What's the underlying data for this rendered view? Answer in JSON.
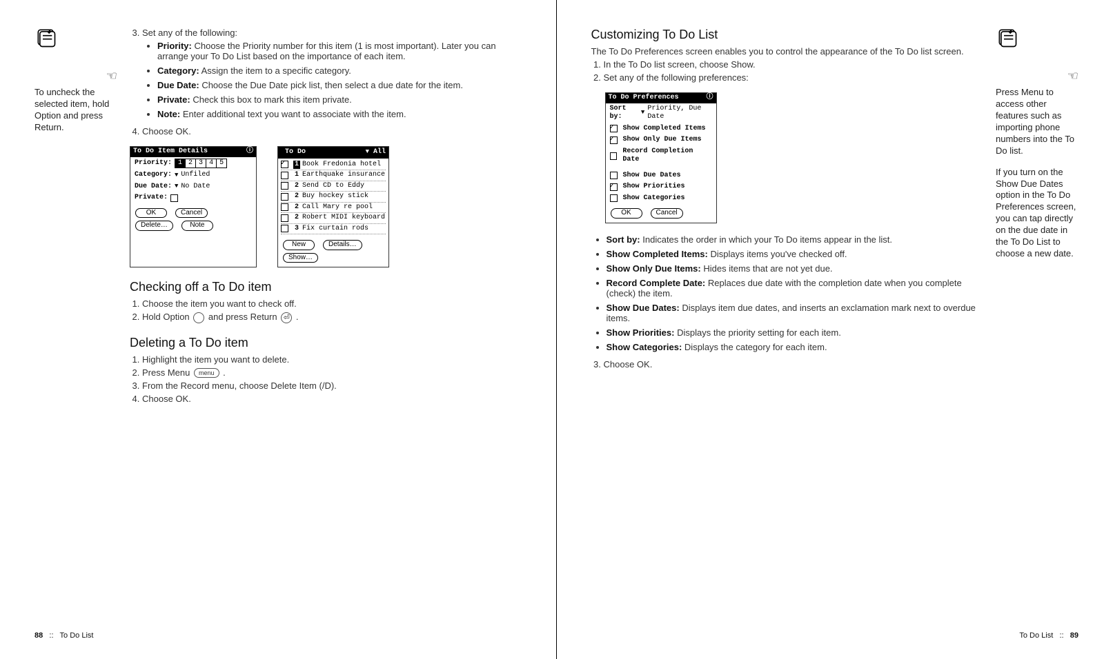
{
  "left": {
    "margin_tip": "To uncheck the selected item, hold Option and press Return.",
    "step3_intro": "Set any of the following:",
    "bullets": [
      {
        "term": "Priority:",
        "text": "Choose the Priority number for this item (1 is most important). Later you can arrange your To Do List based on the importance of each item."
      },
      {
        "term": "Category:",
        "text": "Assign the item to a specific category."
      },
      {
        "term": "Due Date:",
        "text": "Choose the Due Date pick list, then select a due date for the item."
      },
      {
        "term": "Private:",
        "text": "Check this box to mark this item private."
      },
      {
        "term": "Note:",
        "text": "Enter additional text you want to associate with the item."
      }
    ],
    "step4": "Choose OK.",
    "details_screen": {
      "title": "To Do Item Details",
      "priority_label": "Priority:",
      "priorities": [
        "1",
        "2",
        "3",
        "4",
        "5"
      ],
      "selected_priority": "1",
      "category_label": "Category:",
      "category_value": "Unfiled",
      "duedate_label": "Due Date:",
      "duedate_value": "No Date",
      "private_label": "Private:",
      "buttons": [
        "OK",
        "Cancel",
        "Delete…",
        "Note"
      ]
    },
    "todo_screen": {
      "title": "To Do",
      "category": "All",
      "items": [
        {
          "checked": true,
          "pri": "1",
          "pri_on": true,
          "text": "Book Fredonia hotel"
        },
        {
          "checked": false,
          "pri": "1",
          "pri_on": false,
          "text": "Earthquake insurance"
        },
        {
          "checked": false,
          "pri": "2",
          "pri_on": false,
          "text": "Send CD to Eddy"
        },
        {
          "checked": false,
          "pri": "2",
          "pri_on": false,
          "text": "Buy hockey stick"
        },
        {
          "checked": false,
          "pri": "2",
          "pri_on": false,
          "text": "Call Mary re pool"
        },
        {
          "checked": false,
          "pri": "2",
          "pri_on": false,
          "text": "Robert MIDI keyboard"
        },
        {
          "checked": false,
          "pri": "3",
          "pri_on": false,
          "text": "Fix curtain rods"
        }
      ],
      "buttons": [
        "New",
        "Details…",
        "Show…"
      ]
    },
    "checking_heading": "Checking off a To Do item",
    "checking_steps": [
      "Choose the item you want to check off.",
      "Hold Option 〇 and press Return ⏎ ."
    ],
    "deleting_heading": "Deleting a To Do item",
    "deleting_steps": [
      "Highlight the item you want to delete.",
      "Press Menu",
      "From the Record menu, choose Delete Item (/D).",
      "Choose OK."
    ],
    "footer_page": "88",
    "footer_sep": "::",
    "footer_label": "To Do List"
  },
  "right": {
    "heading": "Customizing To Do List",
    "intro": "The To Do Preferences screen enables you to control the appearance of the To Do list screen.",
    "step1": "In the To Do list screen, choose Show.",
    "step2": "Set any of the following preferences:",
    "prefs_screen": {
      "title": "To Do Preferences",
      "sortby_label": "Sort by:",
      "sortby_value": "Priority, Due Date",
      "options": [
        {
          "checked": true,
          "label": "Show Completed Items"
        },
        {
          "checked": true,
          "label": "Show Only Due Items"
        },
        {
          "checked": false,
          "label": "Record Completion Date"
        },
        {
          "checked": false,
          "label": "Show Due Dates"
        },
        {
          "checked": true,
          "label": "Show Priorities"
        },
        {
          "checked": false,
          "label": "Show Categories"
        }
      ],
      "buttons": [
        "OK",
        "Cancel"
      ]
    },
    "pref_bullets": [
      {
        "term": "Sort by:",
        "text": "Indicates the order in which your To Do items appear in the list."
      },
      {
        "term": "Show Completed Items:",
        "text": "Displays items you've checked off."
      },
      {
        "term": "Show Only Due Items:",
        "text": "Hides items that are not yet due."
      },
      {
        "term": "Record Complete Date:",
        "text": "Replaces due date with the completion date when you complete (check) the item."
      },
      {
        "term": "Show Due Dates:",
        "text": "Displays item due dates, and inserts an exclamation mark next to overdue items."
      },
      {
        "term": "Show Priorities:",
        "text": "Displays the priority setting for each item."
      },
      {
        "term": "Show Categories:",
        "text": "Displays the category for each item."
      }
    ],
    "step3": "Choose OK.",
    "margin_tip1": "Press Menu to access other features such as importing phone numbers into the To Do list.",
    "margin_tip2": "If you turn on the Show Due Dates option in the To Do Preferences screen, you can tap directly on the due date in the To Do List to choose a new date.",
    "footer_label": "To Do List",
    "footer_sep": "::",
    "footer_page": "89"
  }
}
